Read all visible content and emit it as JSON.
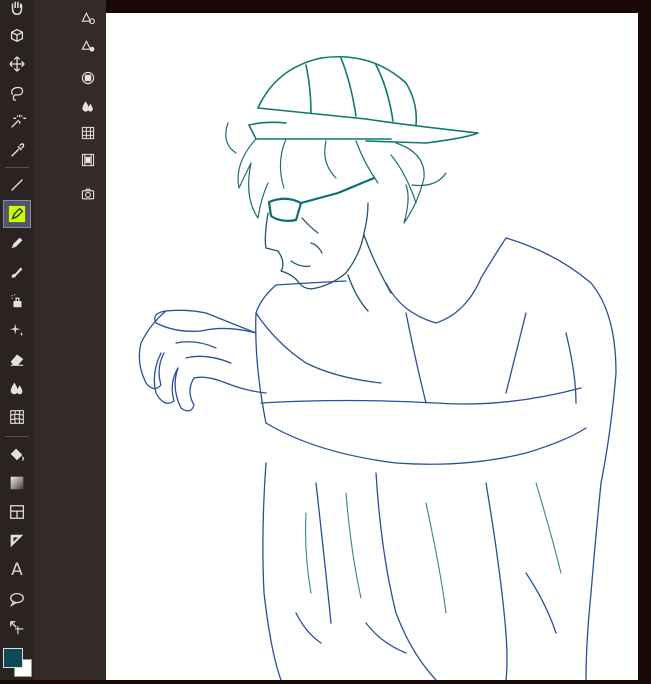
{
  "toolbar": {
    "tools": [
      {
        "name": "hand",
        "icon": "hand-icon"
      },
      {
        "name": "3d",
        "icon": "3d-object-icon"
      },
      {
        "name": "move",
        "icon": "move-icon"
      },
      {
        "name": "lasso",
        "icon": "lasso-icon"
      },
      {
        "name": "magic-wand",
        "icon": "magic-wand-icon"
      },
      {
        "name": "eyedropper",
        "icon": "eyedropper-icon"
      },
      {
        "name": "line",
        "icon": "line-icon"
      },
      {
        "name": "pen",
        "icon": "pen-icon",
        "active": true
      },
      {
        "name": "pencil",
        "icon": "pencil-icon"
      },
      {
        "name": "brush",
        "icon": "brush-icon"
      },
      {
        "name": "airbrush",
        "icon": "airbrush-icon"
      },
      {
        "name": "decoration",
        "icon": "sparkle-icon"
      },
      {
        "name": "eraser",
        "icon": "eraser-icon"
      },
      {
        "name": "blend",
        "icon": "blend-icon"
      },
      {
        "name": "mesh",
        "icon": "mesh-transform-icon"
      },
      {
        "name": "fill",
        "icon": "fill-bucket-icon"
      },
      {
        "name": "gradient",
        "icon": "gradient-icon"
      },
      {
        "name": "frame",
        "icon": "frame-icon"
      },
      {
        "name": "ruler",
        "icon": "ruler-icon"
      },
      {
        "name": "text",
        "icon": "text-icon",
        "glyph": "A"
      },
      {
        "name": "balloon",
        "icon": "speech-balloon-icon"
      },
      {
        "name": "correct-line",
        "icon": "correct-line-icon"
      }
    ],
    "main_color": "#0d4a55",
    "sub_color": "#ffffff"
  },
  "subtools": [
    {
      "icon": "layer-settings-icon"
    },
    {
      "icon": "layer-mask-icon"
    },
    {
      "icon": "circle-layer-icon"
    },
    {
      "icon": "droplets-icon"
    },
    {
      "icon": "grid-icon"
    },
    {
      "icon": "filmstrip-icon"
    },
    {
      "icon": "camera-icon"
    }
  ],
  "colors": {
    "accent_active": "#c8ff00",
    "line_teal": "#0f7a70",
    "line_blue": "#2b4f9a"
  }
}
